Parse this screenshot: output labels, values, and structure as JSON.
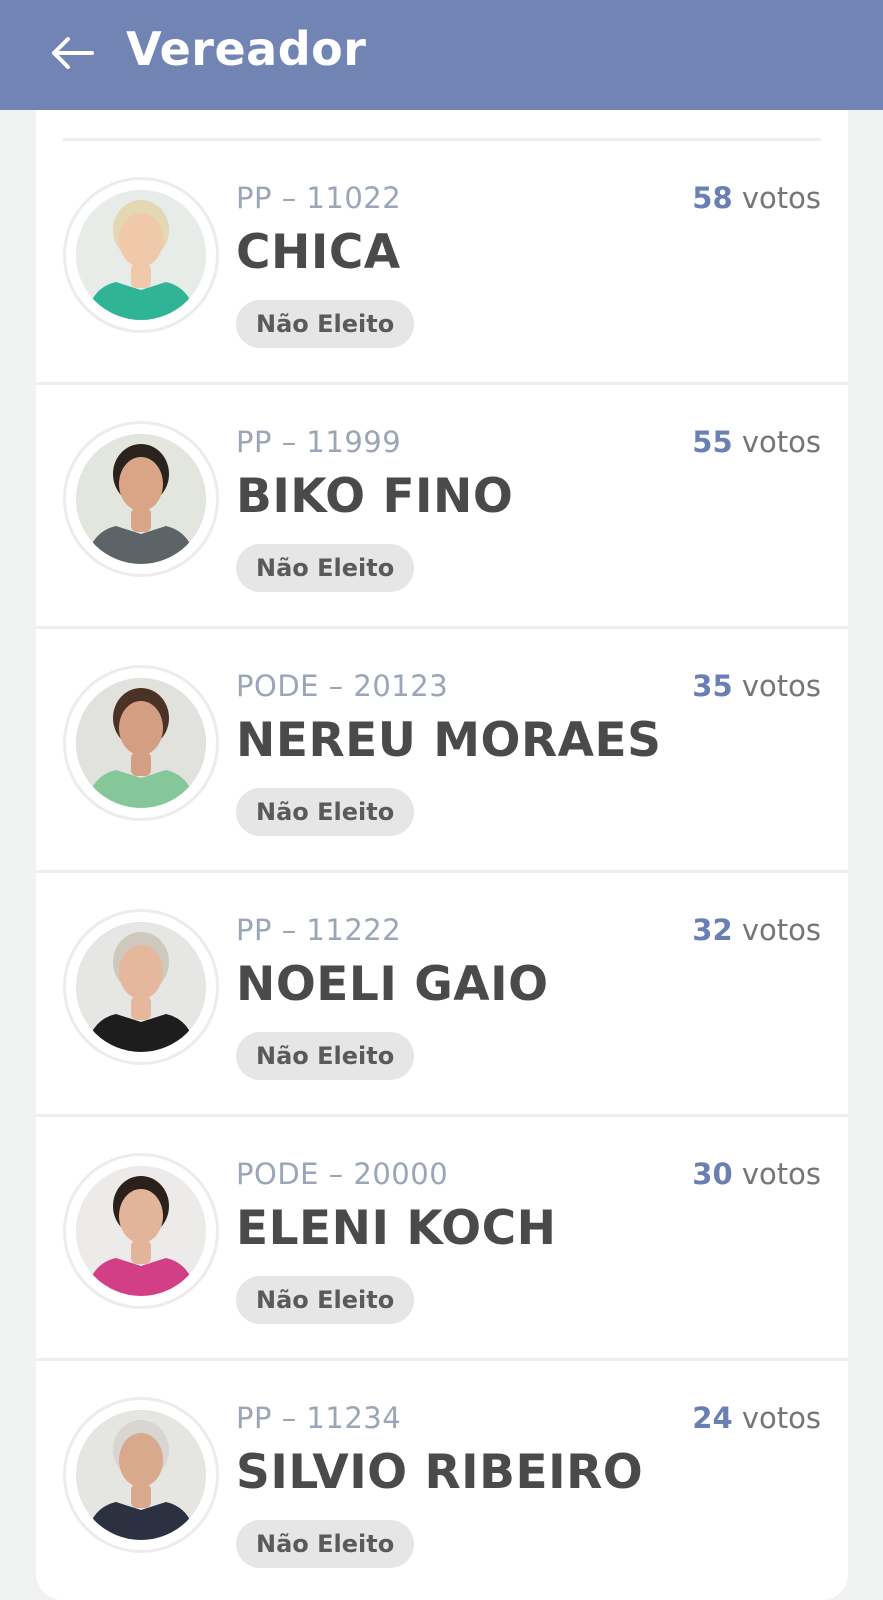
{
  "header": {
    "title": "Vereador",
    "back_icon": "arrow-left-icon"
  },
  "candidates": [
    {
      "party_number": "PP – 11022",
      "votes": "58",
      "votes_unit": " votos",
      "name": "CHICA",
      "status": "Não Eleito",
      "avatar_colors": {
        "bg": "#e8ece8",
        "shirt": "#2fb596",
        "hair": "#e4d7b4",
        "skin": "#f0c9aa"
      }
    },
    {
      "party_number": "PP – 11999",
      "votes": "55",
      "votes_unit": " votos",
      "name": "BIKO FINO",
      "status": "Não Eleito",
      "avatar_colors": {
        "bg": "#e3e6de",
        "shirt": "#5d6467",
        "hair": "#2a221d",
        "skin": "#d9a586"
      }
    },
    {
      "party_number": "PODE – 20123",
      "votes": "35",
      "votes_unit": " votos",
      "name": "NEREU MORAES",
      "status": "Não Eleito",
      "avatar_colors": {
        "bg": "#e1e1dd",
        "shirt": "#86c79a",
        "hair": "#4a3326",
        "skin": "#d39e82"
      }
    },
    {
      "party_number": "PP – 11222",
      "votes": "32",
      "votes_unit": " votos",
      "name": "NOELI GAIO",
      "status": "Não Eleito",
      "avatar_colors": {
        "bg": "#e6e6e4",
        "shirt": "#1d1d1d",
        "hair": "#cfc8bd",
        "skin": "#e5b89e"
      }
    },
    {
      "party_number": "PODE – 20000",
      "votes": "30",
      "votes_unit": " votos",
      "name": "ELENI KOCH",
      "status": "Não Eleito",
      "avatar_colors": {
        "bg": "#ecebea",
        "shirt": "#d23f86",
        "hair": "#2b201c",
        "skin": "#e2b49a"
      }
    },
    {
      "party_number": "PP – 11234",
      "votes": "24",
      "votes_unit": " votos",
      "name": "SILVIO RIBEIRO",
      "status": "Não Eleito",
      "avatar_colors": {
        "bg": "#e5e5e2",
        "shirt": "#2c3142",
        "hair": "#d9d6d2",
        "skin": "#d9a98d"
      }
    }
  ],
  "colors": {
    "header_bg": "#7284b3",
    "votes_accent": "#6a7fb2",
    "badge_bg": "#e6e6e6"
  }
}
